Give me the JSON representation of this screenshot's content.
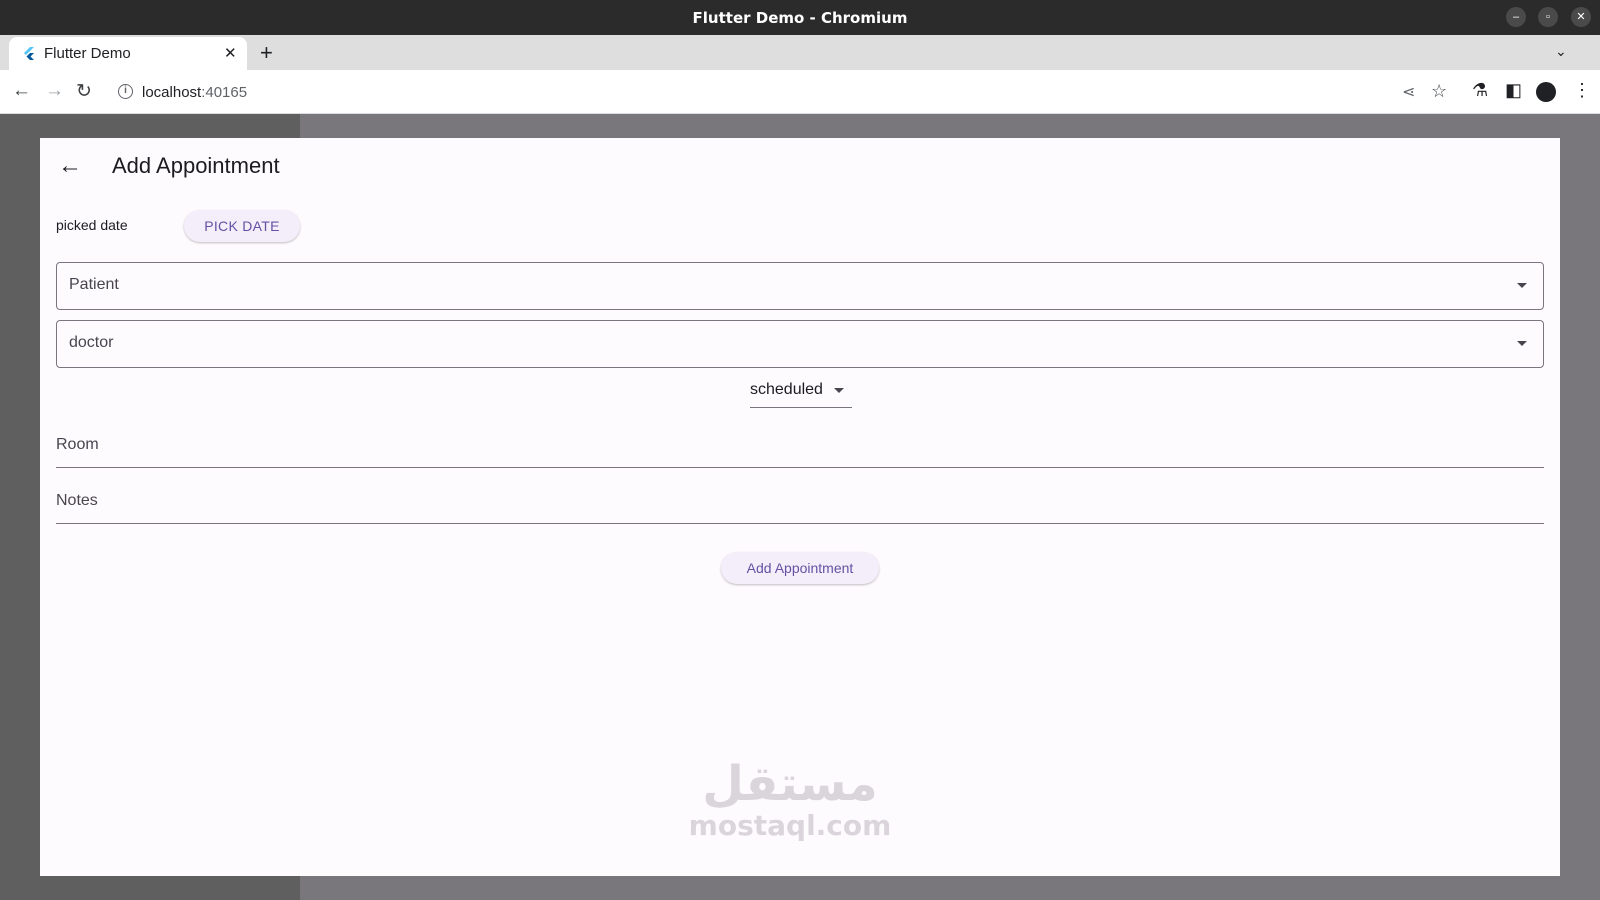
{
  "window": {
    "title": "Flutter Demo - Chromium"
  },
  "browser": {
    "tab_title": "Flutter Demo",
    "url_host": "localhost",
    "url_port": ":40165"
  },
  "app": {
    "title": "Add Appointment",
    "picked_date_label": "picked date",
    "pick_date_button": "PICK DATE",
    "patient_label": "Patient",
    "doctor_label": "doctor",
    "status_value": "scheduled",
    "room_label": "Room",
    "notes_label": "Notes",
    "submit_button": "Add Appointment"
  },
  "watermark": {
    "arabic": "مستقل",
    "latin": "mostaql.com"
  },
  "colors": {
    "primary": "#6750a4",
    "surface": "#fefbff",
    "button_bg": "#f3eefa"
  }
}
